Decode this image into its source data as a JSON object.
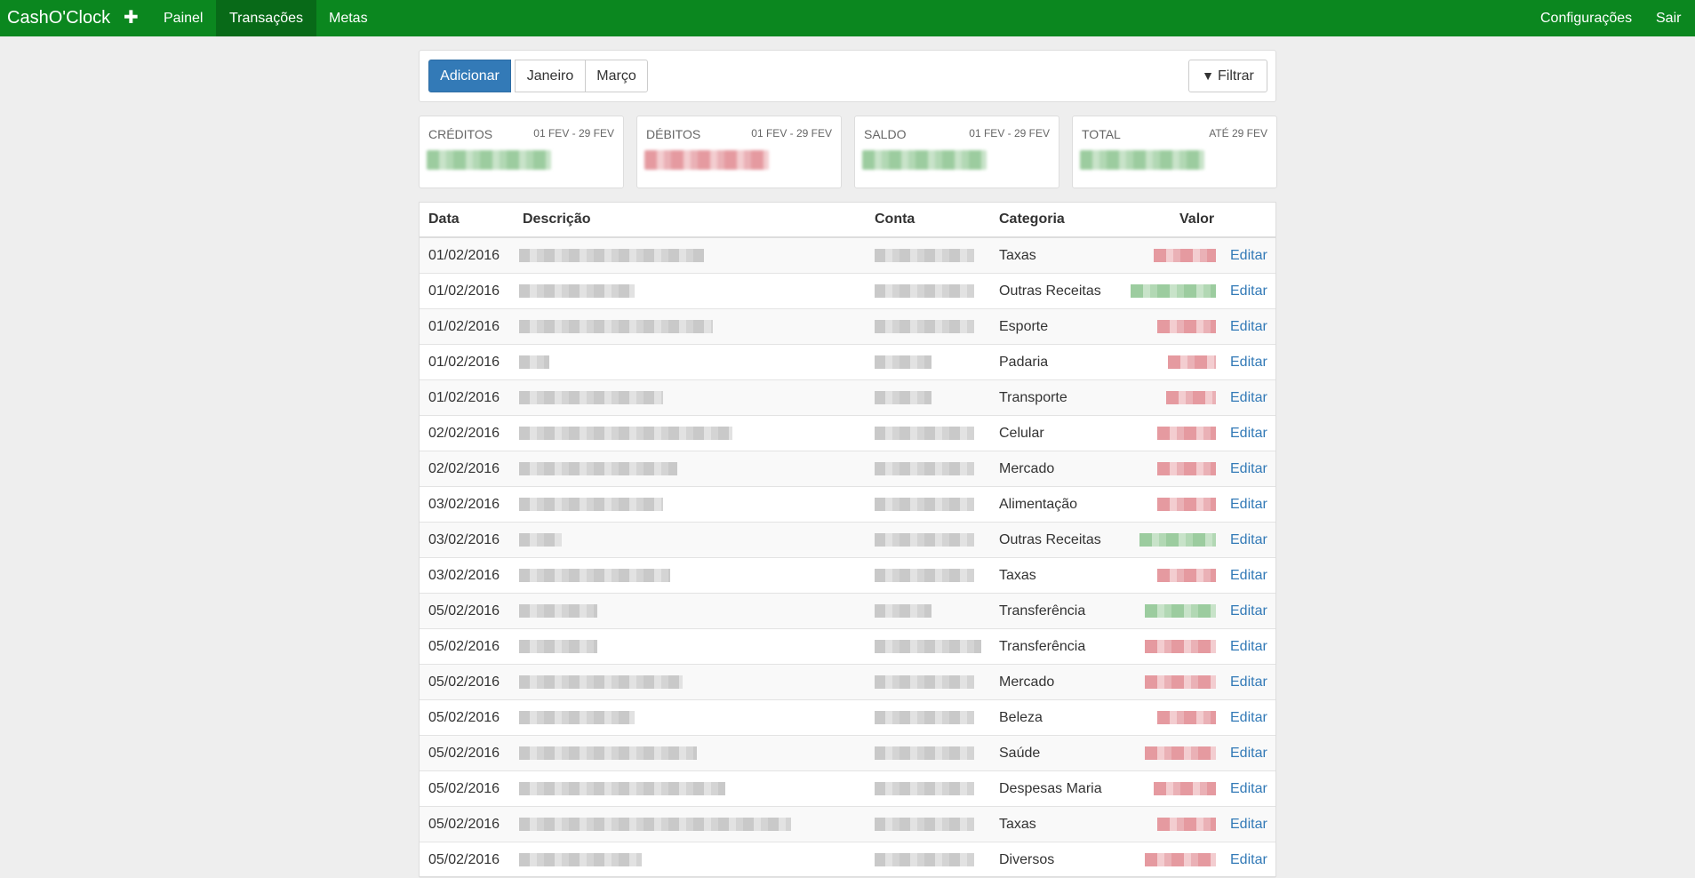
{
  "navbar": {
    "brand": "CashO'Clock",
    "add_icon": "plus-icon",
    "add_symbol": "✚",
    "items": [
      {
        "label": "Painel"
      },
      {
        "label": "Transações",
        "active": true
      },
      {
        "label": "Metas"
      }
    ],
    "right_items": [
      {
        "label": "Configurações"
      },
      {
        "label": "Sair"
      }
    ]
  },
  "toolbar": {
    "add_label": "Adicionar",
    "prev_month_label": "Janeiro",
    "next_month_label": "Março",
    "filter_icon": "funnel-icon",
    "filter_symbol": "▼",
    "filter_label": "Filtrar"
  },
  "summary": [
    {
      "label": "CRÉDITOS",
      "range": "01 FEV - 29 FEV",
      "tone": "green"
    },
    {
      "label": "DÉBITOS",
      "range": "01 FEV - 29 FEV",
      "tone": "red"
    },
    {
      "label": "SALDO",
      "range": "01 FEV - 29 FEV",
      "tone": "green"
    },
    {
      "label": "TOTAL",
      "range": "ATÉ 29 FEV",
      "tone": "green"
    }
  ],
  "table": {
    "headers": {
      "date": "Data",
      "description": "Descrição",
      "account": "Conta",
      "category": "Categoria",
      "value": "Valor"
    },
    "edit_label": "Editar",
    "rows": [
      {
        "date": "01/02/2016",
        "category": "Taxas",
        "tone": "red"
      },
      {
        "date": "01/02/2016",
        "category": "Outras Receitas",
        "tone": "green"
      },
      {
        "date": "01/02/2016",
        "category": "Esporte",
        "tone": "red"
      },
      {
        "date": "01/02/2016",
        "category": "Padaria",
        "tone": "red"
      },
      {
        "date": "01/02/2016",
        "category": "Transporte",
        "tone": "red"
      },
      {
        "date": "02/02/2016",
        "category": "Celular",
        "tone": "red"
      },
      {
        "date": "02/02/2016",
        "category": "Mercado",
        "tone": "red"
      },
      {
        "date": "03/02/2016",
        "category": "Alimentação",
        "tone": "red"
      },
      {
        "date": "03/02/2016",
        "category": "Outras Receitas",
        "tone": "green"
      },
      {
        "date": "03/02/2016",
        "category": "Taxas",
        "tone": "red"
      },
      {
        "date": "05/02/2016",
        "category": "Transferência",
        "tone": "green"
      },
      {
        "date": "05/02/2016",
        "category": "Transferência",
        "tone": "red"
      },
      {
        "date": "05/02/2016",
        "category": "Mercado",
        "tone": "red"
      },
      {
        "date": "05/02/2016",
        "category": "Beleza",
        "tone": "red"
      },
      {
        "date": "05/02/2016",
        "category": "Saúde",
        "tone": "red"
      },
      {
        "date": "05/02/2016",
        "category": "Despesas Maria",
        "tone": "red"
      },
      {
        "date": "05/02/2016",
        "category": "Taxas",
        "tone": "red"
      },
      {
        "date": "05/02/2016",
        "category": "Diversos",
        "tone": "red"
      }
    ]
  },
  "colors": {
    "navbar": "#0b871f",
    "navbar_active": "#086a18",
    "primary": "#337ab7",
    "credit": "#5cb85c",
    "debit": "#d9534f"
  }
}
